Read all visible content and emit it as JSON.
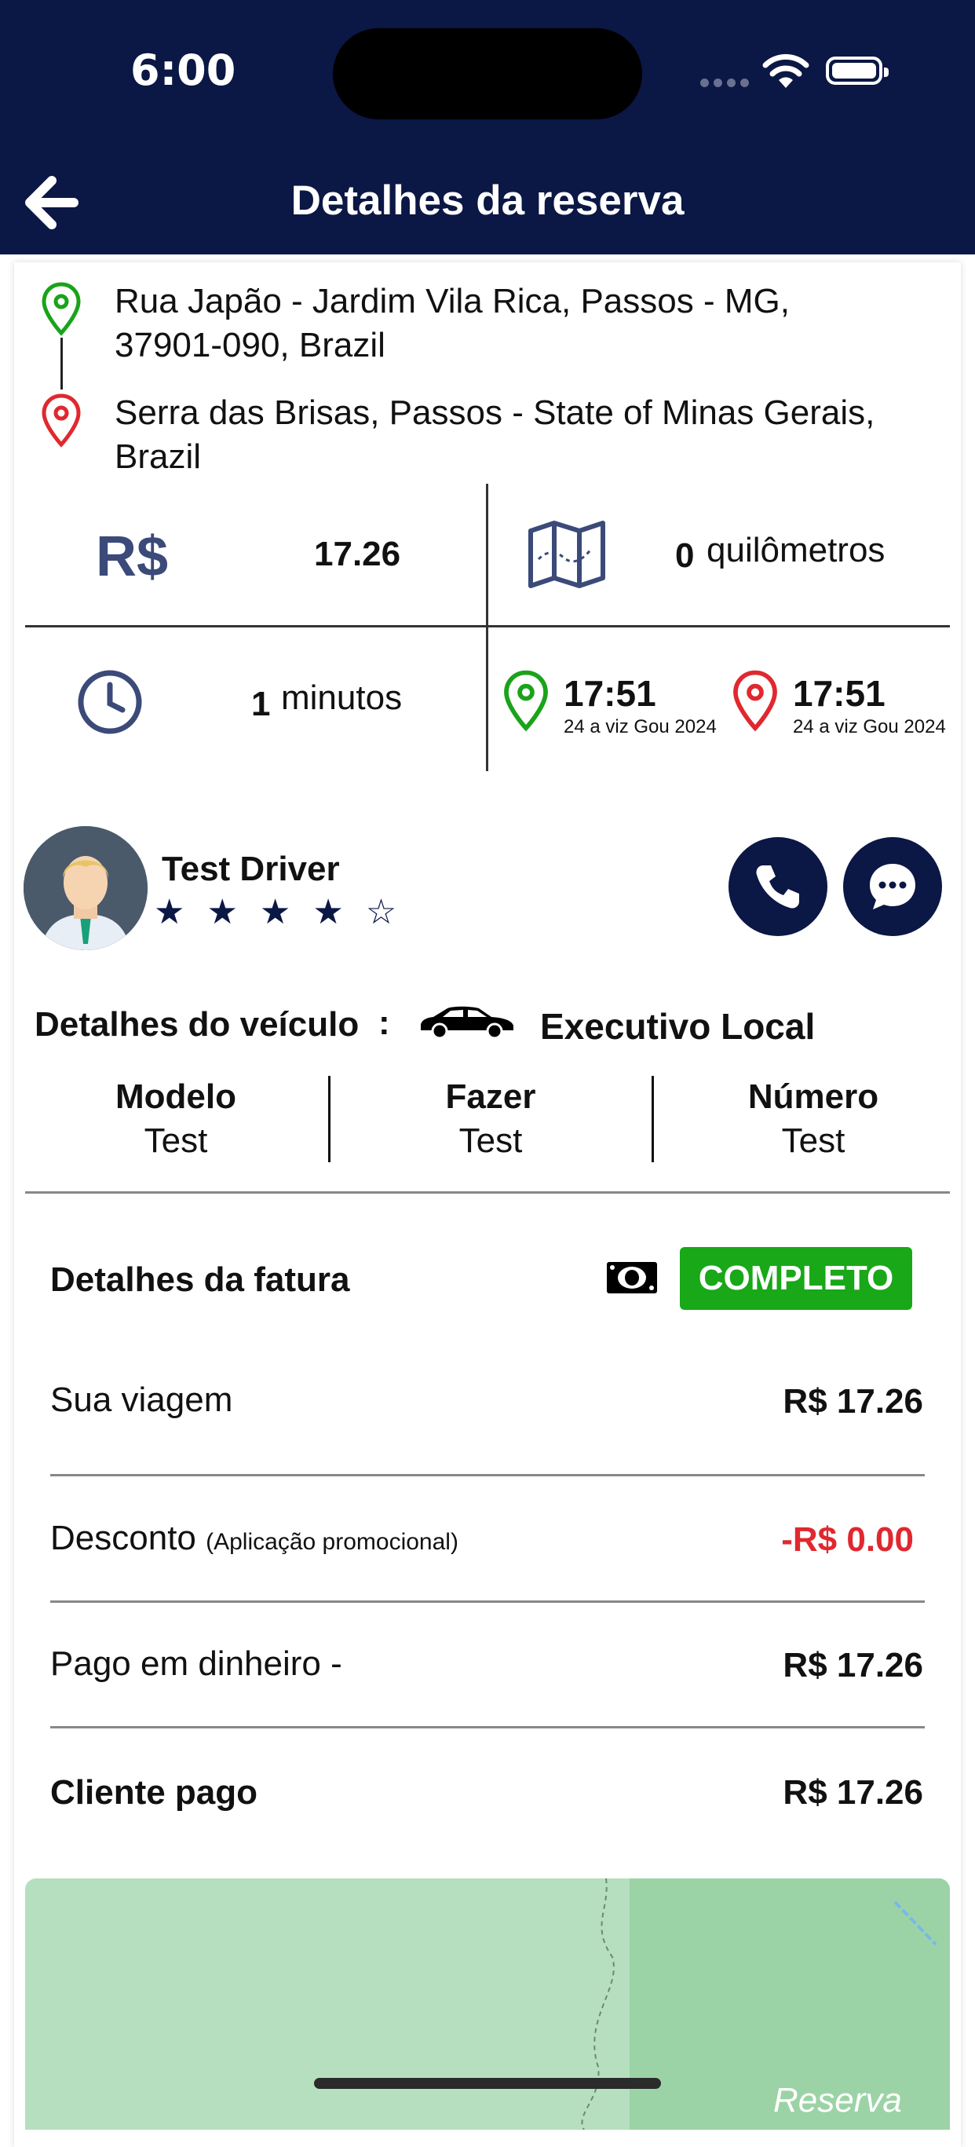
{
  "status_bar": {
    "time": "6:00"
  },
  "header": {
    "title": "Detalhes da reserva"
  },
  "route": {
    "pickup": "Rua Japão - Jardim Vila Rica, Passos - MG, 37901-090, Brazil",
    "dropoff": "Serra das Brisas, Passos - State of Minas Gerais, Brazil"
  },
  "stats": {
    "currency_symbol": "R$",
    "fare": "17.26",
    "distance_value": "0",
    "distance_unit": "quilômetros",
    "duration_value": "1",
    "duration_unit": "minutos",
    "start_time": "17:51",
    "start_date": "24 a viz Gou 2024",
    "end_time": "17:51",
    "end_date": "24 a viz Gou 2024"
  },
  "driver": {
    "name": "Test Driver",
    "rating": 4.5,
    "stars": "★★★★☆"
  },
  "vehicle": {
    "label": "Detalhes do veículo",
    "separator": ":",
    "type": "Executivo Local",
    "columns": [
      {
        "header": "Modelo",
        "value": "Test"
      },
      {
        "header": "Fazer",
        "value": "Test"
      },
      {
        "header": "Número",
        "value": "Test"
      }
    ]
  },
  "invoice": {
    "title": "Detalhes da fatura",
    "status": "COMPLETO",
    "rows": [
      {
        "label": "Sua viagem",
        "note": "",
        "value": "R$ 17.26"
      },
      {
        "label": "Desconto",
        "note": "(Aplicação promocional)",
        "value": "-R$ 0.00"
      },
      {
        "label": "Pago em dinheiro -",
        "note": "",
        "value": "R$ 17.26"
      },
      {
        "label": "Cliente pago",
        "note": "",
        "value": "R$ 17.26"
      }
    ]
  },
  "map": {
    "label": "Reserva"
  },
  "colors": {
    "primary": "#0b1744",
    "success": "#18a818",
    "danger": "#e0282f",
    "pickup_pin": "#1aa31a",
    "dropoff_pin": "#e0282f"
  }
}
